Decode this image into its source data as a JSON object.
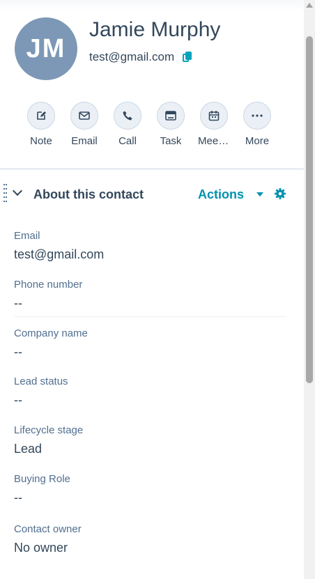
{
  "contact": {
    "initials": "JM",
    "name": "Jamie Murphy",
    "email": "test@gmail.com",
    "avatar_color": "#7c98b6"
  },
  "quick_actions": [
    {
      "label": "Note",
      "icon": "edit-icon"
    },
    {
      "label": "Email",
      "icon": "email-icon"
    },
    {
      "label": "Call",
      "icon": "phone-icon"
    },
    {
      "label": "Task",
      "icon": "task-icon"
    },
    {
      "label": "Meeti...",
      "icon": "calendar-icon"
    },
    {
      "label": "More",
      "icon": "more-icon"
    }
  ],
  "section": {
    "title": "About this contact",
    "actions_label": "Actions"
  },
  "properties": [
    {
      "label": "Email",
      "value": "test@gmail.com"
    },
    {
      "label": "Phone number",
      "value": "--"
    },
    {
      "label": "Company name",
      "value": "--"
    },
    {
      "label": "Lead status",
      "value": "--"
    },
    {
      "label": "Lifecycle stage",
      "value": "Lead"
    },
    {
      "label": "Buying Role",
      "value": "--"
    },
    {
      "label": "Contact owner",
      "value": "No owner"
    }
  ],
  "colors": {
    "accent": "#0091ae",
    "text": "#33475b",
    "label": "#516f90",
    "button_bg": "#eaf0f6"
  }
}
